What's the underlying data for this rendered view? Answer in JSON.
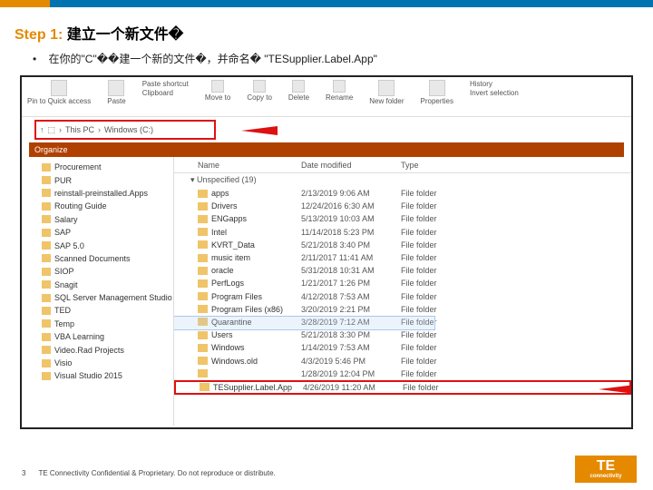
{
  "title_prefix": "Step 1:",
  "title_rest": " 建立一个新文件�",
  "bullet": "•",
  "instruction": "在你的\"C\"��建一个新的文件�，并命名� \"TESupplier.Label.App\"",
  "ribbon": {
    "pin": "Pin to Quick access",
    "paste": "Paste",
    "shortcut": "Paste shortcut",
    "clipboard": "Clipboard",
    "move": "Move to",
    "copy": "Copy to",
    "delete": "Delete",
    "rename": "Rename",
    "organize": "Organize",
    "new": "New folder",
    "props": "Properties",
    "history": "History",
    "select": "Invert selection"
  },
  "addr": {
    "seg1": "This PC",
    "seg2": "Windows (C:)",
    "arrow": "›"
  },
  "organize": "Organize",
  "listhdr": {
    "name": "Name",
    "date": "Date modified",
    "type": "Type"
  },
  "group": "Unspecified (19)",
  "tree": [
    "Procurement",
    "PUR",
    "reinstall-preinstalled.Apps",
    "Routing Guide",
    "Salary",
    "SAP",
    "SAP 5.0",
    "Scanned Documents",
    "SIOP",
    "Snagit",
    "SQL Server Management Studio",
    "TED",
    "Temp",
    "VBA Learning",
    "Video.Rad Projects",
    "Visio",
    "Visual Studio 2015"
  ],
  "rows": [
    {
      "n": "apps",
      "d": "2/13/2019 9:06 AM",
      "t": "File folder"
    },
    {
      "n": "Drivers",
      "d": "12/24/2016 6:30 AM",
      "t": "File folder"
    },
    {
      "n": "ENGapps",
      "d": "5/13/2019 10:03 AM",
      "t": "File folder"
    },
    {
      "n": "Intel",
      "d": "11/14/2018 5:23 PM",
      "t": "File folder"
    },
    {
      "n": "KVRT_Data",
      "d": "5/21/2018 3:40 PM",
      "t": "File folder"
    },
    {
      "n": "music item",
      "d": "2/11/2017 11:41 AM",
      "t": "File folder"
    },
    {
      "n": "oracle",
      "d": "5/31/2018 10:31 AM",
      "t": "File folder"
    },
    {
      "n": "PerfLogs",
      "d": "1/21/2017 1:26 PM",
      "t": "File folder"
    },
    {
      "n": "Program Files",
      "d": "4/12/2018 7:53 AM",
      "t": "File folder"
    },
    {
      "n": "Program Files (x86)",
      "d": "3/20/2019 2:21 PM",
      "t": "File folder"
    },
    {
      "n": "Quarantine",
      "d": "3/28/2019 7:12 AM",
      "t": "File folder",
      "sel": true
    },
    {
      "n": "Users",
      "d": "5/21/2018 3:30 PM",
      "t": "File folder"
    },
    {
      "n": "Windows",
      "d": "1/14/2019 7:53 AM",
      "t": "File folder"
    },
    {
      "n": "Windows.old",
      "d": "4/3/2019 5:46 PM",
      "t": "File folder"
    },
    {
      "n": "",
      "d": "1/28/2019 12:04 PM",
      "t": "File folder"
    },
    {
      "n": "TESupplier.Label.App",
      "d": "4/26/2019 11:20 AM",
      "t": "File folder",
      "hl": true
    }
  ],
  "footer": {
    "page": "3",
    "legal": "TE Connectivity Confidential & Proprietary. Do not reproduce or distribute."
  },
  "logo": {
    "t": "TE",
    "c": "connectivity"
  }
}
